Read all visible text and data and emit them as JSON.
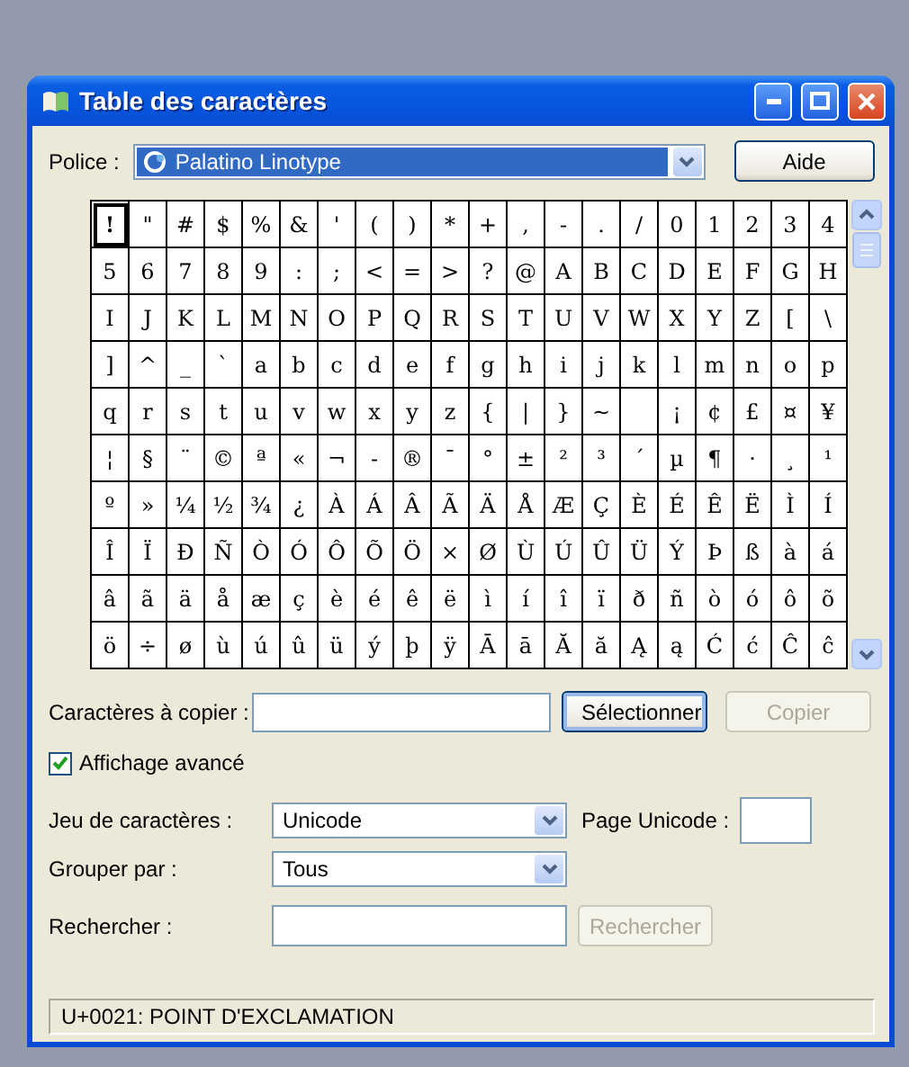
{
  "window": {
    "title": "Table des caractères"
  },
  "font": {
    "label": "Police :",
    "value": "Palatino Linotype",
    "highlighted": true
  },
  "help_button": "Aide",
  "grid": {
    "rows": [
      [
        {
          "char": "!",
          "selected": true
        },
        {
          "char": "\"",
          "selected": false
        },
        {
          "char": "#",
          "selected": false
        },
        {
          "char": "$",
          "selected": false
        },
        {
          "char": "%",
          "selected": false
        },
        {
          "char": "&",
          "selected": false
        },
        {
          "char": "'",
          "selected": false
        },
        {
          "char": "(",
          "selected": false
        },
        {
          "char": ")",
          "selected": false
        },
        {
          "char": "*",
          "selected": false
        },
        {
          "char": "+",
          "selected": false
        },
        {
          "char": ",",
          "selected": false
        },
        {
          "char": "-",
          "selected": false
        },
        {
          "char": ".",
          "selected": false
        },
        {
          "char": "/",
          "selected": false
        },
        {
          "char": "0",
          "selected": false
        },
        {
          "char": "1",
          "selected": false
        },
        {
          "char": "2",
          "selected": false
        },
        {
          "char": "3",
          "selected": false
        },
        {
          "char": "4",
          "selected": false
        }
      ],
      [
        {
          "char": "5",
          "selected": false
        },
        {
          "char": "6",
          "selected": false
        },
        {
          "char": "7",
          "selected": false
        },
        {
          "char": "8",
          "selected": false
        },
        {
          "char": "9",
          "selected": false
        },
        {
          "char": ":",
          "selected": false
        },
        {
          "char": ";",
          "selected": false
        },
        {
          "char": "<",
          "selected": false
        },
        {
          "char": "=",
          "selected": false
        },
        {
          "char": ">",
          "selected": false
        },
        {
          "char": "?",
          "selected": false
        },
        {
          "char": "@",
          "selected": false
        },
        {
          "char": "A",
          "selected": false
        },
        {
          "char": "B",
          "selected": false
        },
        {
          "char": "C",
          "selected": false
        },
        {
          "char": "D",
          "selected": false
        },
        {
          "char": "E",
          "selected": false
        },
        {
          "char": "F",
          "selected": false
        },
        {
          "char": "G",
          "selected": false
        },
        {
          "char": "H",
          "selected": false
        }
      ],
      [
        {
          "char": "I",
          "selected": false
        },
        {
          "char": "J",
          "selected": false
        },
        {
          "char": "K",
          "selected": false
        },
        {
          "char": "L",
          "selected": false
        },
        {
          "char": "M",
          "selected": false
        },
        {
          "char": "N",
          "selected": false
        },
        {
          "char": "O",
          "selected": false
        },
        {
          "char": "P",
          "selected": false
        },
        {
          "char": "Q",
          "selected": false
        },
        {
          "char": "R",
          "selected": false
        },
        {
          "char": "S",
          "selected": false
        },
        {
          "char": "T",
          "selected": false
        },
        {
          "char": "U",
          "selected": false
        },
        {
          "char": "V",
          "selected": false
        },
        {
          "char": "W",
          "selected": false
        },
        {
          "char": "X",
          "selected": false
        },
        {
          "char": "Y",
          "selected": false
        },
        {
          "char": "Z",
          "selected": false
        },
        {
          "char": "[",
          "selected": false
        },
        {
          "char": "\\",
          "selected": false
        }
      ],
      [
        {
          "char": "]",
          "selected": false
        },
        {
          "char": "^",
          "selected": false
        },
        {
          "char": "_",
          "selected": false
        },
        {
          "char": "`",
          "selected": false
        },
        {
          "char": "a",
          "selected": false
        },
        {
          "char": "b",
          "selected": false
        },
        {
          "char": "c",
          "selected": false
        },
        {
          "char": "d",
          "selected": false
        },
        {
          "char": "e",
          "selected": false
        },
        {
          "char": "f",
          "selected": false
        },
        {
          "char": "g",
          "selected": false
        },
        {
          "char": "h",
          "selected": false
        },
        {
          "char": "i",
          "selected": false
        },
        {
          "char": "j",
          "selected": false
        },
        {
          "char": "k",
          "selected": false
        },
        {
          "char": "l",
          "selected": false
        },
        {
          "char": "m",
          "selected": false
        },
        {
          "char": "n",
          "selected": false
        },
        {
          "char": "o",
          "selected": false
        },
        {
          "char": "p",
          "selected": false
        }
      ],
      [
        {
          "char": "q",
          "selected": false
        },
        {
          "char": "r",
          "selected": false
        },
        {
          "char": "s",
          "selected": false
        },
        {
          "char": "t",
          "selected": false
        },
        {
          "char": "u",
          "selected": false
        },
        {
          "char": "v",
          "selected": false
        },
        {
          "char": "w",
          "selected": false
        },
        {
          "char": "x",
          "selected": false
        },
        {
          "char": "y",
          "selected": false
        },
        {
          "char": "z",
          "selected": false
        },
        {
          "char": "{",
          "selected": false
        },
        {
          "char": "|",
          "selected": false
        },
        {
          "char": "}",
          "selected": false
        },
        {
          "char": "~",
          "selected": false
        },
        {
          "selected": false
        },
        {
          "char": "¡",
          "selected": false
        },
        {
          "char": "¢",
          "selected": false
        },
        {
          "char": "£",
          "selected": false
        },
        {
          "char": "¤",
          "selected": false
        },
        {
          "char": "¥",
          "selected": false
        }
      ],
      [
        {
          "char": "¦",
          "selected": false
        },
        {
          "char": "§",
          "selected": false
        },
        {
          "char": "¨",
          "selected": false
        },
        {
          "char": "©",
          "selected": false
        },
        {
          "char": "ª",
          "selected": false
        },
        {
          "char": "«",
          "selected": false
        },
        {
          "char": "¬",
          "selected": false
        },
        {
          "char": "-",
          "selected": false
        },
        {
          "char": "®",
          "selected": false
        },
        {
          "char": "¯",
          "selected": false
        },
        {
          "char": "°",
          "selected": false
        },
        {
          "char": "±",
          "selected": false
        },
        {
          "char": "²",
          "selected": false
        },
        {
          "char": "³",
          "selected": false
        },
        {
          "char": "´",
          "selected": false
        },
        {
          "char": "µ",
          "selected": false
        },
        {
          "char": "¶",
          "selected": false
        },
        {
          "char": "·",
          "selected": false
        },
        {
          "char": "¸",
          "selected": false
        },
        {
          "char": "¹",
          "selected": false
        }
      ],
      [
        {
          "char": "º",
          "selected": false
        },
        {
          "char": "»",
          "selected": false
        },
        {
          "char": "¼",
          "selected": false
        },
        {
          "char": "½",
          "selected": false
        },
        {
          "char": "¾",
          "selected": false
        },
        {
          "char": "¿",
          "selected": false
        },
        {
          "char": "À",
          "selected": false
        },
        {
          "char": "Á",
          "selected": false
        },
        {
          "char": "Â",
          "selected": false
        },
        {
          "char": "Ã",
          "selected": false
        },
        {
          "char": "Ä",
          "selected": false
        },
        {
          "char": "Å",
          "selected": false
        },
        {
          "char": "Æ",
          "selected": false
        },
        {
          "char": "Ç",
          "selected": false
        },
        {
          "char": "È",
          "selected": false
        },
        {
          "char": "É",
          "selected": false
        },
        {
          "char": "Ê",
          "selected": false
        },
        {
          "char": "Ë",
          "selected": false
        },
        {
          "char": "Ì",
          "selected": false
        },
        {
          "char": "Í",
          "selected": false
        }
      ],
      [
        {
          "char": "Î",
          "selected": false
        },
        {
          "char": "Ï",
          "selected": false
        },
        {
          "char": "Ð",
          "selected": false
        },
        {
          "char": "Ñ",
          "selected": false
        },
        {
          "char": "Ò",
          "selected": false
        },
        {
          "char": "Ó",
          "selected": false
        },
        {
          "char": "Ô",
          "selected": false
        },
        {
          "char": "Õ",
          "selected": false
        },
        {
          "char": "Ö",
          "selected": false
        },
        {
          "char": "×",
          "selected": false
        },
        {
          "char": "Ø",
          "selected": false
        },
        {
          "char": "Ù",
          "selected": false
        },
        {
          "char": "Ú",
          "selected": false
        },
        {
          "char": "Û",
          "selected": false
        },
        {
          "char": "Ü",
          "selected": false
        },
        {
          "char": "Ý",
          "selected": false
        },
        {
          "char": "Þ",
          "selected": false
        },
        {
          "char": "ß",
          "selected": false
        },
        {
          "char": "à",
          "selected": false
        },
        {
          "char": "á",
          "selected": false
        }
      ],
      [
        {
          "char": "â",
          "selected": false
        },
        {
          "char": "ã",
          "selected": false
        },
        {
          "char": "ä",
          "selected": false
        },
        {
          "char": "å",
          "selected": false
        },
        {
          "char": "æ",
          "selected": false
        },
        {
          "char": "ç",
          "selected": false
        },
        {
          "char": "è",
          "selected": false
        },
        {
          "char": "é",
          "selected": false
        },
        {
          "char": "ê",
          "selected": false
        },
        {
          "char": "ë",
          "selected": false
        },
        {
          "char": "ì",
          "selected": false
        },
        {
          "char": "í",
          "selected": false
        },
        {
          "char": "î",
          "selected": false
        },
        {
          "char": "ï",
          "selected": false
        },
        {
          "char": "ð",
          "selected": false
        },
        {
          "char": "ñ",
          "selected": false
        },
        {
          "char": "ò",
          "selected": false
        },
        {
          "char": "ó",
          "selected": false
        },
        {
          "char": "ô",
          "selected": false
        },
        {
          "char": "õ",
          "selected": false
        }
      ],
      [
        {
          "char": "ö",
          "selected": false
        },
        {
          "char": "÷",
          "selected": false
        },
        {
          "char": "ø",
          "selected": false
        },
        {
          "char": "ù",
          "selected": false
        },
        {
          "char": "ú",
          "selected": false
        },
        {
          "char": "û",
          "selected": false
        },
        {
          "char": "ü",
          "selected": false
        },
        {
          "char": "ý",
          "selected": false
        },
        {
          "char": "þ",
          "selected": false
        },
        {
          "char": "ÿ",
          "selected": false
        },
        {
          "char": "Ā",
          "selected": false
        },
        {
          "char": "ā",
          "selected": false
        },
        {
          "char": "Ă",
          "selected": false
        },
        {
          "char": "ă",
          "selected": false
        },
        {
          "char": "Ą",
          "selected": false
        },
        {
          "char": "ą",
          "selected": false
        },
        {
          "char": "Ć",
          "selected": false
        },
        {
          "char": "ć",
          "selected": false
        },
        {
          "char": "Ĉ",
          "selected": false
        },
        {
          "char": "ĉ",
          "selected": false
        }
      ]
    ]
  },
  "copy": {
    "label": "Caractères à copier :",
    "select_button": {
      "label": "Sélectionner",
      "disabled": false
    },
    "copy_button": {
      "label": "Copier",
      "disabled": true
    }
  },
  "advanced_view": {
    "label": "Affichage avancé",
    "checked": true
  },
  "charset": {
    "label": "Jeu de caractères :",
    "value": "Unicode"
  },
  "unicode_page": {
    "label": "Page Unicode :"
  },
  "group_by": {
    "label": "Grouper par :",
    "value": "Tous"
  },
  "search": {
    "label": "Rechercher :",
    "button": {
      "label": "Rechercher",
      "disabled": true
    }
  },
  "status_bar": "U+0021: POINT D'EXCLAMATION"
}
